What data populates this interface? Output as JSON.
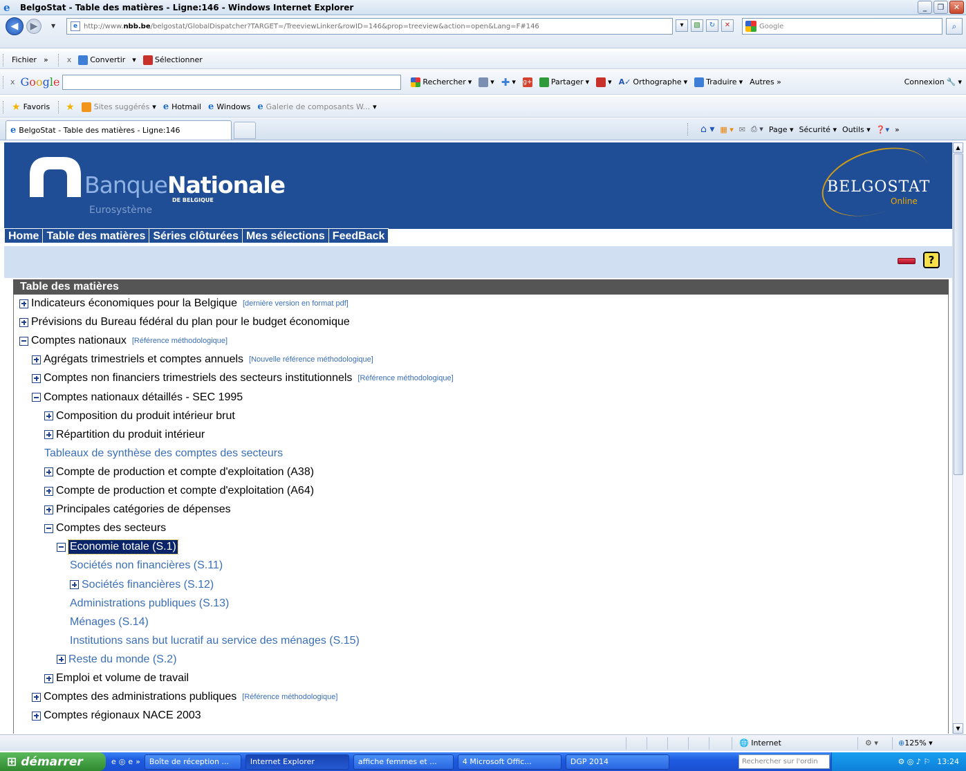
{
  "window": {
    "title": "BelgoStat  - Table des matières - Ligne:146 - Windows Internet Explorer",
    "minimize": "_",
    "maximize": "❐",
    "close": "✕"
  },
  "address_bar": {
    "url_prefix": "http://www.",
    "url_domain": "nbb.be",
    "url_rest": "/belgostat/GlobalDispatcher?TARGET=/TreeviewLinker&rowID=146&prop=treeview&action=open&Lang=F#146",
    "search_placeholder": "Google"
  },
  "menu_bar": {
    "file": "Fichier",
    "more": "»",
    "close": "x",
    "convert": "Convertir",
    "select": "Sélectionner"
  },
  "google_bar": {
    "close": "x",
    "logo": "Google",
    "search": "Rechercher",
    "share": "Partager",
    "spell": "Orthographe",
    "translate": "Traduire",
    "others": "Autres »",
    "login": "Connexion"
  },
  "favorites_bar": {
    "favorites": "Favoris",
    "suggested": "Sites suggérés",
    "hotmail": "Hotmail",
    "windows": "Windows",
    "gallery": "Galerie de composants W..."
  },
  "tab": {
    "label": "BelgoStat  - Table des matières - Ligne:146"
  },
  "command_bar": {
    "page": "Page",
    "security": "Sécurité",
    "tools": "Outils",
    "more": "»"
  },
  "site": {
    "logo_light": "Banque",
    "logo_bold": "Nationale",
    "logo_sub": "DE BELGIQUE",
    "logo_euro": "Eurosystème",
    "belgostat": "BELGOSTAT",
    "belgostat_online": "Online",
    "nav": [
      "Home",
      "Table des matières",
      "Séries clôturées",
      "Mes sélections",
      "FeedBack"
    ],
    "help_icon": "?",
    "toc_title": "Table des matières"
  },
  "tree": [
    {
      "label": "Indicateurs économiques pour la Belgique",
      "ref": "[dernière version en format pdf]",
      "expander": "plus",
      "link": false
    },
    {
      "label": "Prévisions du Bureau fédéral du plan pour le budget économique",
      "ref": "",
      "expander": "plus",
      "link": false
    },
    {
      "label": "Comptes nationaux",
      "ref": "[Référence méthodologique]",
      "expander": "minus",
      "link": false
    },
    {
      "label": "Agrégats trimestriels et comptes annuels",
      "ref": "[Nouvelle référence méthodologique]",
      "expander": "plus",
      "link": false
    },
    {
      "label": "Comptes non financiers trimestriels des secteurs institutionnels",
      "ref": "[Référence méthodologique]",
      "expander": "plus",
      "link": false
    },
    {
      "label": "Comptes nationaux détaillés - SEC 1995",
      "ref": "",
      "expander": "minus",
      "link": false
    },
    {
      "label": "Composition du produit intérieur brut",
      "ref": "",
      "expander": "plus",
      "link": false
    },
    {
      "label": "Répartition du produit intérieur",
      "ref": "",
      "expander": "plus",
      "link": false
    },
    {
      "label": "Tableaux de synthèse des comptes des secteurs",
      "ref": "",
      "expander": "none",
      "link": true
    },
    {
      "label": "Compte de production et compte d'exploitation (A38)",
      "ref": "",
      "expander": "plus",
      "link": false
    },
    {
      "label": "Compte de production et compte d'exploitation (A64)",
      "ref": "",
      "expander": "plus",
      "link": false
    },
    {
      "label": "Principales catégories de dépenses",
      "ref": "",
      "expander": "plus",
      "link": false
    },
    {
      "label": "Comptes des secteurs",
      "ref": "",
      "expander": "minus",
      "link": false
    },
    {
      "label": "Economie totale (S.1)",
      "ref": "",
      "expander": "minus",
      "link": false,
      "selected": true
    },
    {
      "label": "Sociétés non financières (S.11)",
      "ref": "",
      "expander": "none",
      "link": true
    },
    {
      "label": "Sociétés financières (S.12)",
      "ref": "",
      "expander": "plus",
      "link": true
    },
    {
      "label": "Administrations publiques (S.13)",
      "ref": "",
      "expander": "none",
      "link": true
    },
    {
      "label": "Ménages (S.14)",
      "ref": "",
      "expander": "none",
      "link": true
    },
    {
      "label": "Institutions sans but lucratif au service des ménages (S.15)",
      "ref": "",
      "expander": "none",
      "link": true
    },
    {
      "label": "Reste du monde (S.2)",
      "ref": "",
      "expander": "plus",
      "link": true
    },
    {
      "label": "Emploi et volume de travail",
      "ref": "",
      "expander": "plus",
      "link": false
    },
    {
      "label": "Comptes des administrations publiques",
      "ref": "[Référence méthodologique]",
      "expander": "plus",
      "link": false
    },
    {
      "label": "Comptes régionaux NACE 2003",
      "ref": "",
      "expander": "plus",
      "link": false
    }
  ],
  "status_bar": {
    "zone": "Internet",
    "zoom": "125%"
  },
  "taskbar": {
    "start": "démarrer",
    "items": [
      "Boîte de réception ...",
      "Internet Explorer",
      "affiche femmes et ...",
      "4 Microsoft Offic...",
      "DGP 2014"
    ],
    "search_placeholder": "Rechercher sur l'ordin",
    "clock": "13:24"
  }
}
